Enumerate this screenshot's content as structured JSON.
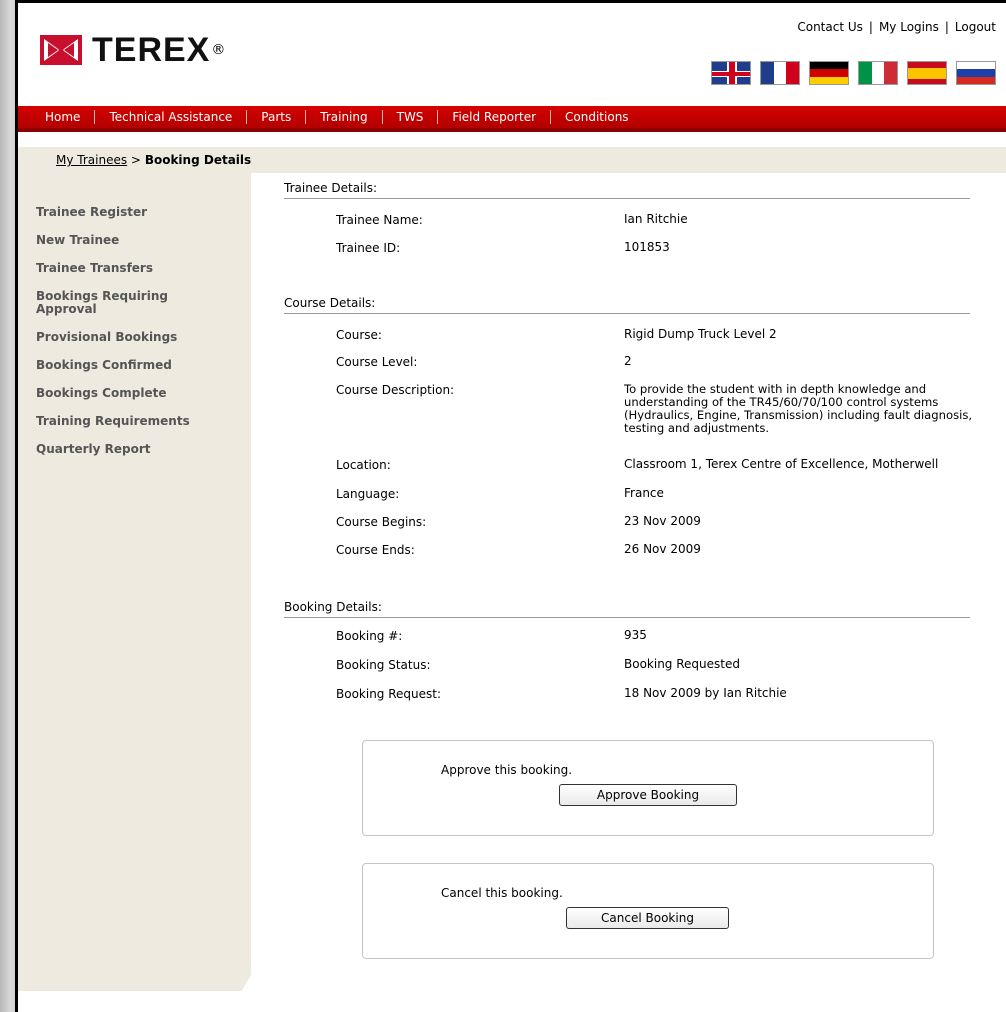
{
  "brand": {
    "name": "TEREX",
    "mark": "®"
  },
  "toplinks": [
    "Contact Us",
    "My Logins",
    "Logout"
  ],
  "flags": [
    "uk-flag-icon",
    "france-flag-icon",
    "germany-flag-icon",
    "italy-flag-icon",
    "spain-flag-icon",
    "russia-flag-icon"
  ],
  "nav": [
    "Home",
    "Technical Assistance",
    "Parts",
    "Training",
    "TWS",
    "Field Reporter",
    "Conditions"
  ],
  "breadcrumb": {
    "link": "My Trainees",
    "sep": ">",
    "current": "Booking Details"
  },
  "sidebar": [
    "Trainee Register",
    "New Trainee",
    "Trainee Transfers",
    "Bookings Requiring Approval",
    "Provisional Bookings",
    "Bookings Confirmed",
    "Bookings Complete",
    "Training Requirements",
    "Quarterly Report"
  ],
  "trainee": {
    "title": "Trainee Details:",
    "name_label": "Trainee Name:",
    "name": "Ian Ritchie",
    "id_label": "Trainee ID:",
    "id": "101853"
  },
  "course": {
    "title": "Course Details:",
    "course_label": "Course:",
    "course": "Rigid Dump Truck Level 2",
    "level_label": "Course Level:",
    "level": "2",
    "desc_label": "Course Description:",
    "desc": "To provide the student with in depth knowledge and understanding of the TR45/60/70/100 control systems (Hydraulics, Engine, Transmission) including fault diagnosis, testing and adjustments.",
    "location_label": "Location:",
    "location": "Classroom 1, Terex Centre of Excellence, Motherwell",
    "language_label": "Language:",
    "language": "France",
    "begins_label": "Course Begins:",
    "begins": "23 Nov 2009",
    "ends_label": "Course Ends:",
    "ends": "26 Nov 2009"
  },
  "booking": {
    "title": "Booking Details:",
    "number_label": "Booking #:",
    "number": "935",
    "status_label": "Booking Status:",
    "status": "Booking Requested",
    "request_label": "Booking Request:",
    "request": "18 Nov 2009 by Ian Ritchie"
  },
  "approve": {
    "text": "Approve this booking.",
    "button": "Approve Booking"
  },
  "cancel": {
    "text": "Cancel this booking.",
    "button": "Cancel Booking"
  },
  "colors": {
    "nav_red": "#c00000",
    "sidebar_bg": "#efeae0",
    "brand_red": "#c8102e"
  }
}
